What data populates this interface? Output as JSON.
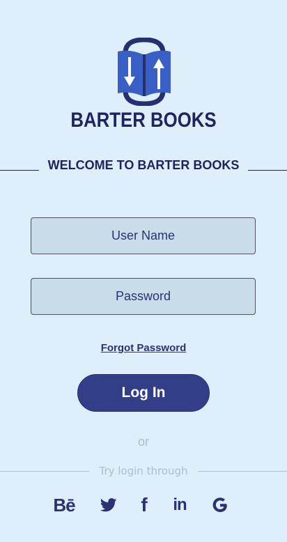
{
  "brand": {
    "name": "BARTER BOOKS",
    "logo_icon": "book-exchange-icon",
    "primary_color": "#2a3275",
    "accent_color": "#3a5fc4"
  },
  "welcome": {
    "title": "WELCOME TO BARTER BOOKS"
  },
  "form": {
    "username_placeholder": "User Name",
    "password_placeholder": "Password",
    "forgot_label": "Forgot Password",
    "login_label": "Log In"
  },
  "alt_login": {
    "or_label": "or",
    "try_label": "Try login through",
    "providers": [
      {
        "name": "behance",
        "glyph": "Bē",
        "icon": "behance-icon"
      },
      {
        "name": "twitter",
        "icon": "twitter-icon"
      },
      {
        "name": "facebook",
        "glyph": "f",
        "icon": "facebook-icon"
      },
      {
        "name": "linkedin",
        "glyph": "in",
        "icon": "linkedin-icon"
      },
      {
        "name": "google",
        "icon": "google-icon"
      }
    ]
  },
  "colors": {
    "background": "#deeefa",
    "input_fill": "#c8dcea",
    "button_fill": "#323e87",
    "muted_text": "#a9c0cf"
  }
}
